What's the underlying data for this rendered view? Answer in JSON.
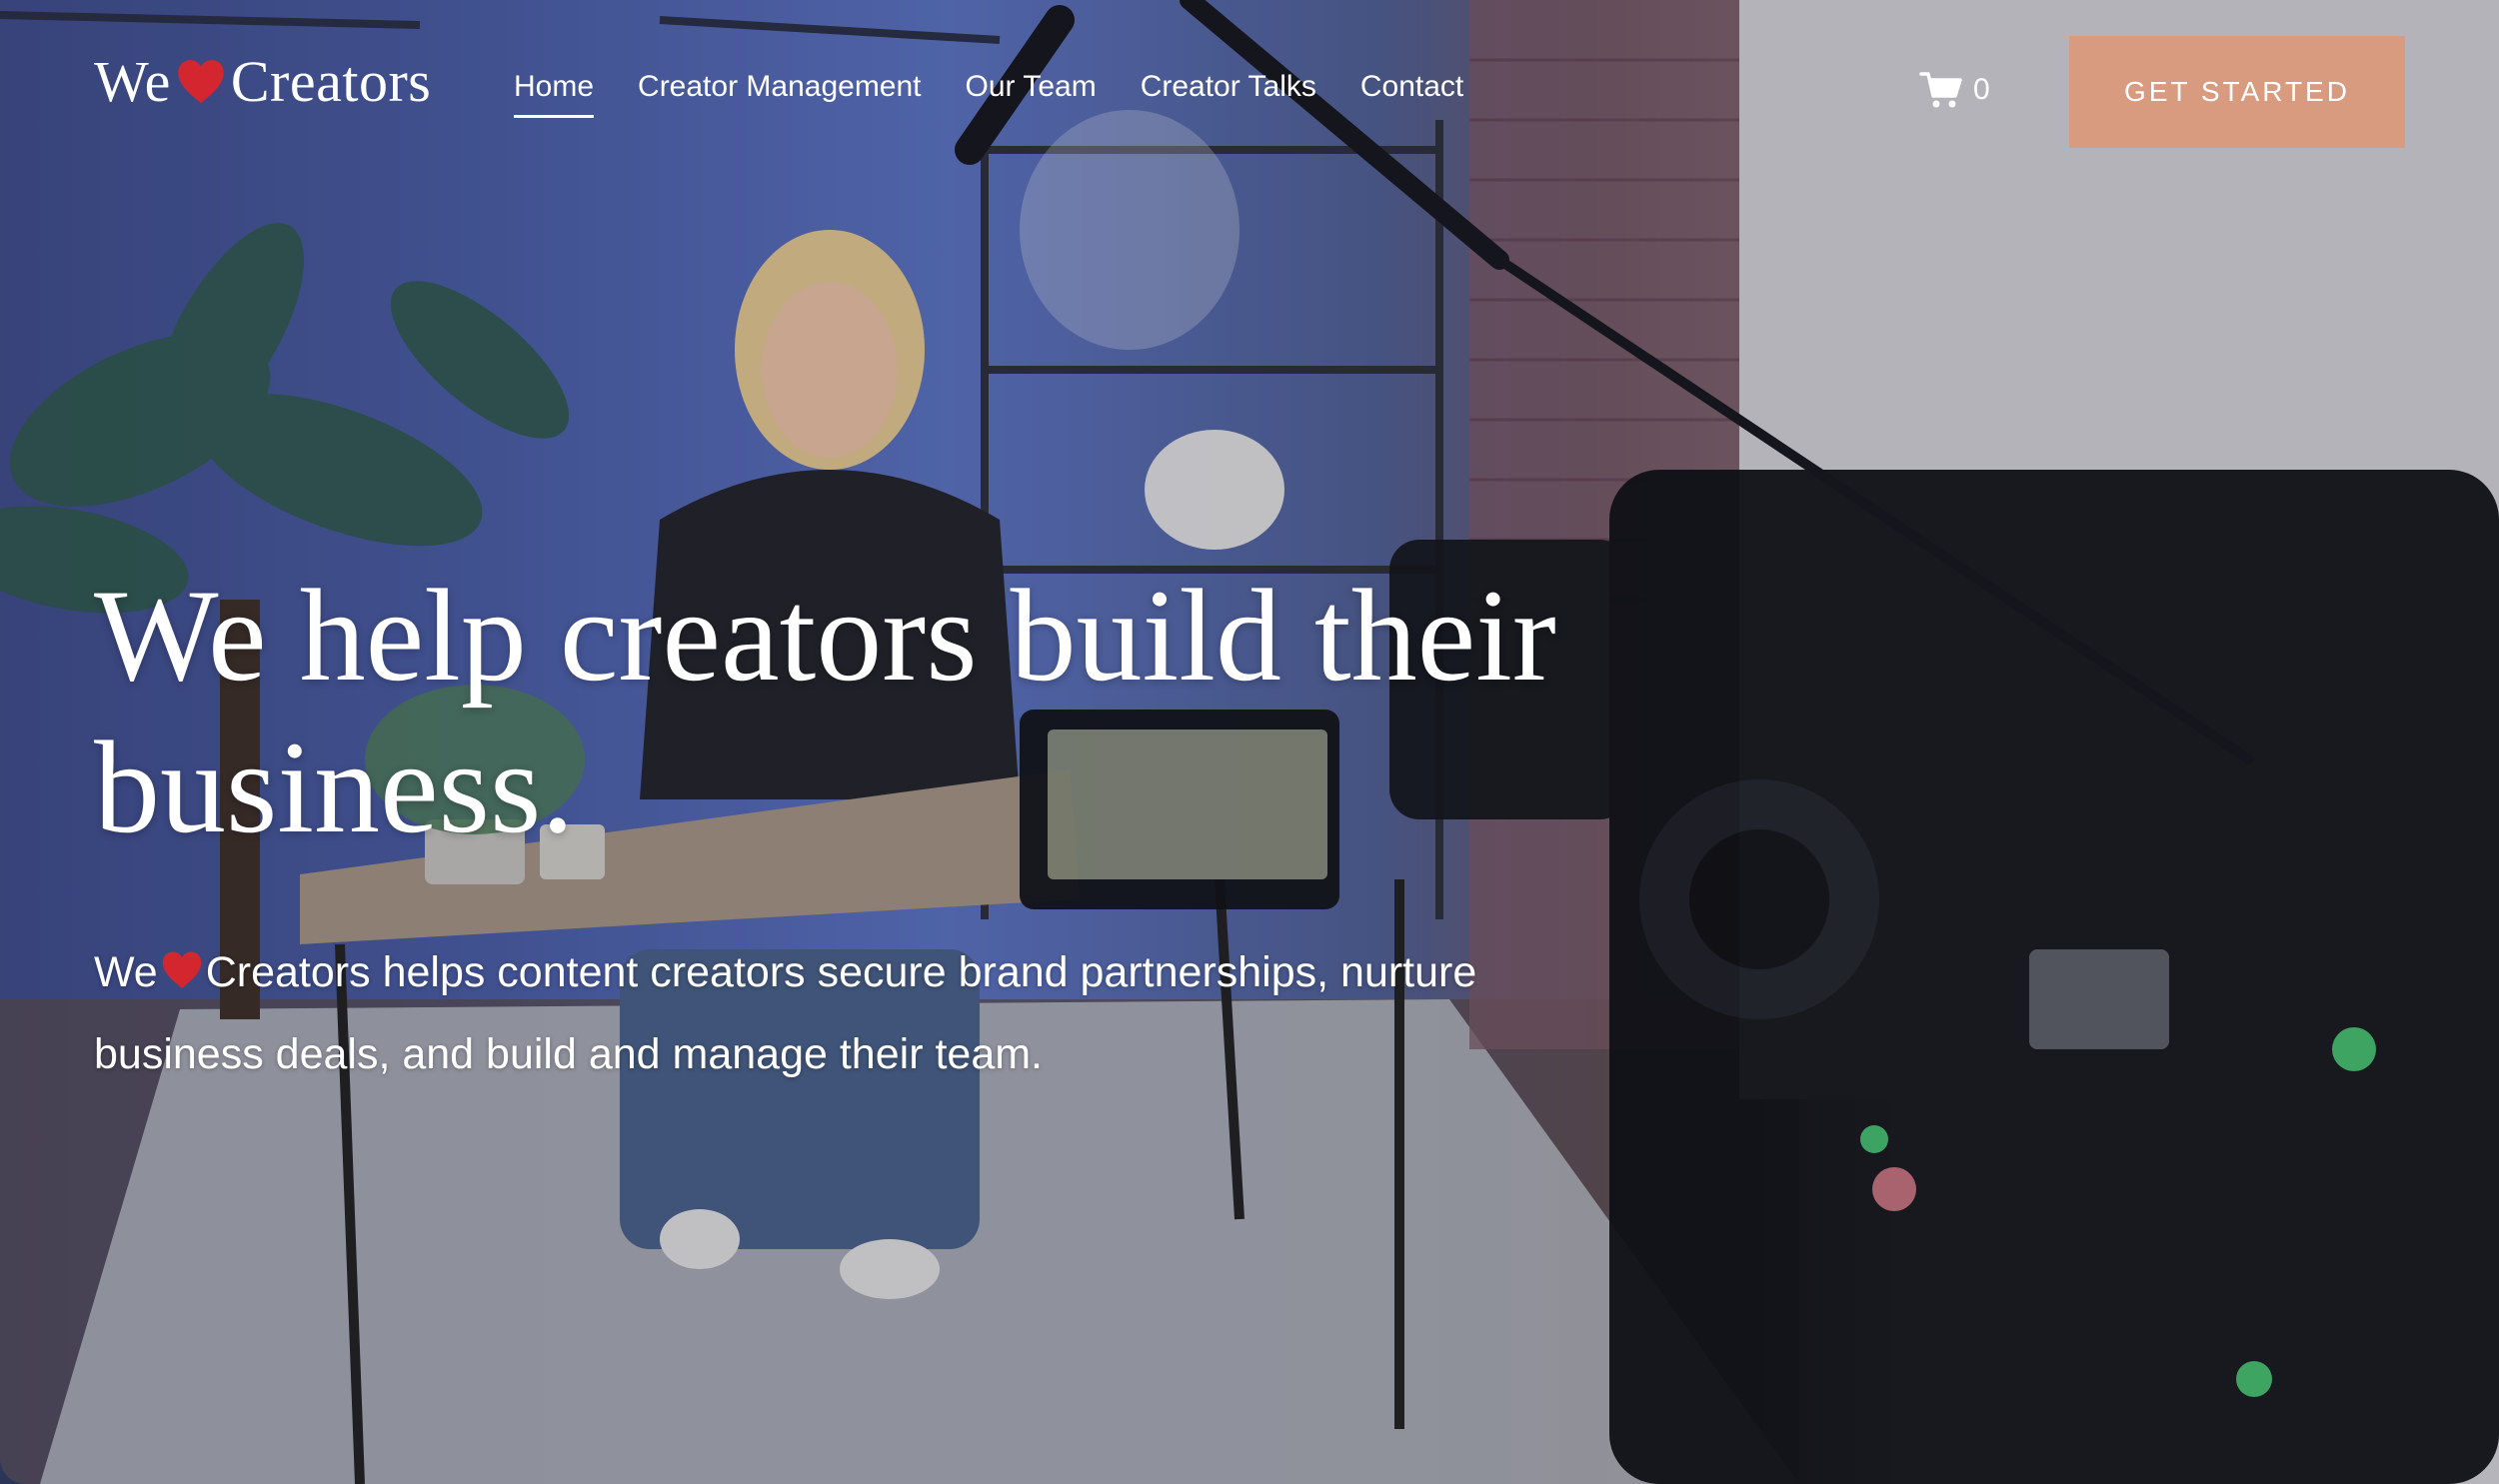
{
  "brand": {
    "prefix": "We",
    "suffix": "Creators",
    "heart_color": "#d4262e"
  },
  "nav": {
    "items": [
      {
        "label": "Home",
        "active": true
      },
      {
        "label": "Creator Management",
        "active": false
      },
      {
        "label": "Our Team",
        "active": false
      },
      {
        "label": "Creator Talks",
        "active": false
      },
      {
        "label": "Contact",
        "active": false
      }
    ]
  },
  "cart": {
    "icon": "cart-icon",
    "count": "0"
  },
  "cta": {
    "label": "GET STARTED",
    "color": "#d99b80"
  },
  "hero": {
    "headline": "We help creators build their business.",
    "sub_prefix": "We",
    "sub_rest": "Creators helps content creators secure brand partnerships, nurture business deals, and build and manage their team."
  }
}
